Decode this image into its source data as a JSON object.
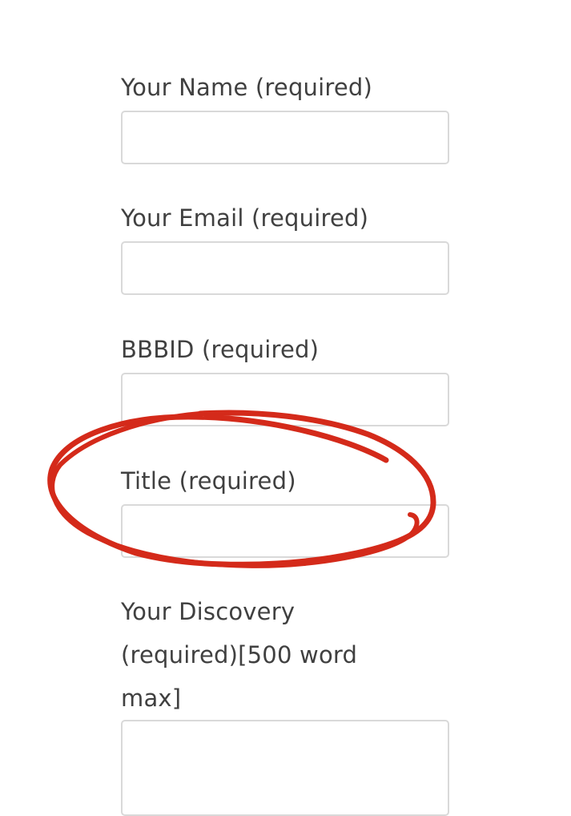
{
  "form": {
    "name_label": "Your Name (required)",
    "email_label": "Your Email (required)",
    "bbbid_label": "BBBID (required)",
    "title_label": "Title (required)",
    "discovery_label": "Your Discovery (required)[500 word max]",
    "name_value": "",
    "email_value": "",
    "bbbid_value": "",
    "title_value": "",
    "discovery_value": ""
  },
  "annotation": {
    "color": "#d42a1a"
  }
}
